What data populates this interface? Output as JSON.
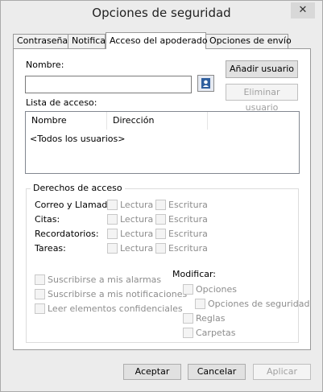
{
  "window": {
    "title": "Opciones de seguridad",
    "close_glyph": "✕"
  },
  "tabs": [
    {
      "label": "Contraseña"
    },
    {
      "label": "Notificar"
    },
    {
      "label": "Acceso del apoderado"
    },
    {
      "label": "Opciones de envío"
    }
  ],
  "proxy": {
    "name_label": "Nombre:",
    "name_value": "",
    "address_book_icon": "address-book-icon",
    "add_user": "Añadir usuario",
    "remove_user": "Eliminar usuario",
    "access_list_label": "Lista de acceso:",
    "columns": [
      "Nombre",
      "Dirección"
    ],
    "rows": [
      "<Todos los usuarios>"
    ]
  },
  "rights": {
    "title": "Derechos de acceso",
    "read_label": "Lectura",
    "write_label": "Escritura",
    "items": [
      {
        "label": "Correo y Llamada:"
      },
      {
        "label": "Citas:"
      },
      {
        "label": "Recordatorios:"
      },
      {
        "label": "Tareas:"
      }
    ],
    "subscribe_alarms": "Suscribirse a mis alarmas",
    "subscribe_notifications": "Suscribirse a mis notificaciones",
    "read_confidential": "Leer elementos confidenciales",
    "modify_label": "Modificar:",
    "modify_options": "Opciones",
    "modify_security_options": "Opciones de seguridad",
    "modify_rules": "Reglas",
    "modify_folders": "Carpetas"
  },
  "footer": {
    "ok": "Aceptar",
    "cancel": "Cancelar",
    "apply": "Aplicar"
  }
}
